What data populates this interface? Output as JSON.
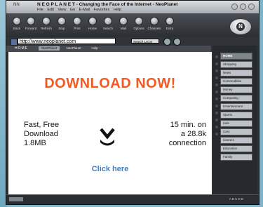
{
  "window": {
    "logo_text": "NN",
    "title": "N E O P L A N E T - Changing the Face of the Internet - NeoPlanet",
    "menu": "File Edit View Go E-Mail Favorites Help"
  },
  "toolbar": {
    "items": [
      "Back",
      "Forward",
      "Refresh",
      "Stop",
      "Print",
      "Home",
      "Search",
      "Mail",
      "Options",
      "Channels",
      "Extra"
    ],
    "brand_glyph": "N"
  },
  "address": {
    "url": "http://www.neoplanet.com",
    "search_label": "Search Lycos"
  },
  "tabbar": {
    "home_label": "HOME",
    "tabs": [
      {
        "label": "StartPlanet",
        "active": true
      },
      {
        "label": "NeoPlanet",
        "active": false
      },
      {
        "label": "Help",
        "active": false
      }
    ]
  },
  "content": {
    "headline": "DOWNLOAD NOW!",
    "left_lines": [
      "Fast, Free",
      "Download",
      "1.8MB"
    ],
    "right_lines": [
      "15 min. on",
      "a 28.8k",
      "connection"
    ],
    "cta": "Click here"
  },
  "sidebar": {
    "items": [
      {
        "label": "HOME",
        "active": true
      },
      {
        "label": "Shopping"
      },
      {
        "label": "News"
      },
      {
        "label": "Commodities"
      },
      {
        "label": "Money"
      },
      {
        "label": "Computing"
      },
      {
        "label": "Entertainment"
      },
      {
        "label": "Sports"
      },
      {
        "label": "Kids"
      },
      {
        "label": "Cars"
      },
      {
        "label": "Careers"
      },
      {
        "label": "Education"
      },
      {
        "label": "Family"
      }
    ]
  },
  "status": {
    "right_text": "A B C D E"
  },
  "colors": {
    "headline": "#f15a24",
    "link": "#3f7fc1"
  }
}
